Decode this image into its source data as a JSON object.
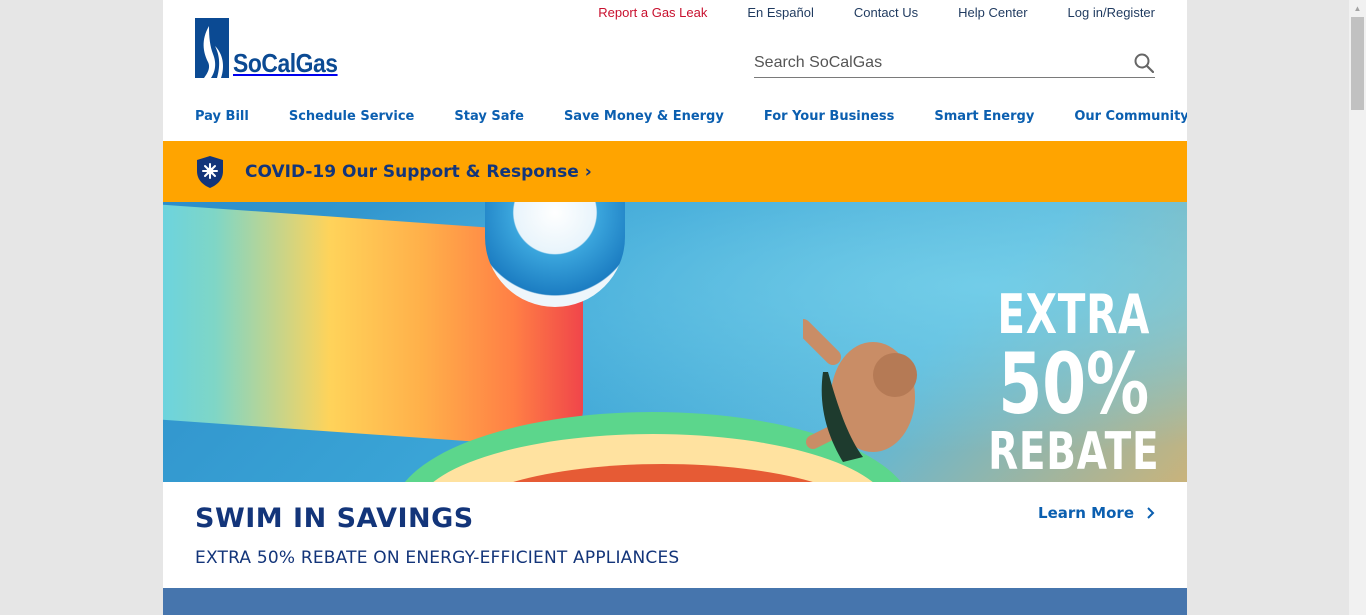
{
  "utility_links": {
    "report_leak": "Report a Gas Leak",
    "espanol": "En Español",
    "contact": "Contact Us",
    "help": "Help Center",
    "login": "Log in/Register"
  },
  "logo": {
    "text": "SoCalGas"
  },
  "search": {
    "placeholder": "Search SoCalGas"
  },
  "nav": {
    "items": [
      {
        "label": "Pay Bill"
      },
      {
        "label": "Schedule Service"
      },
      {
        "label": "Stay Safe"
      },
      {
        "label": "Save Money & Energy"
      },
      {
        "label": "For Your Business"
      },
      {
        "label": "Smart Energy"
      },
      {
        "label": "Our Community"
      }
    ]
  },
  "covid_banner": {
    "text": "COVID-19 Our Support & Response",
    "chevron": "›"
  },
  "hero": {
    "line1": "EXTRA",
    "line2": "50%",
    "line3": "REBATE"
  },
  "promo": {
    "title": "SWIM IN SAVINGS",
    "subtitle": "EXTRA 50% REBATE ON ENERGY-EFFICIENT APPLIANCES",
    "learn_more": "Learn More"
  },
  "colors": {
    "brand_blue": "#0b4a93",
    "nav_blue": "#0b5fb0",
    "banner_orange": "#ffa400",
    "leak_red": "#c8102e"
  }
}
